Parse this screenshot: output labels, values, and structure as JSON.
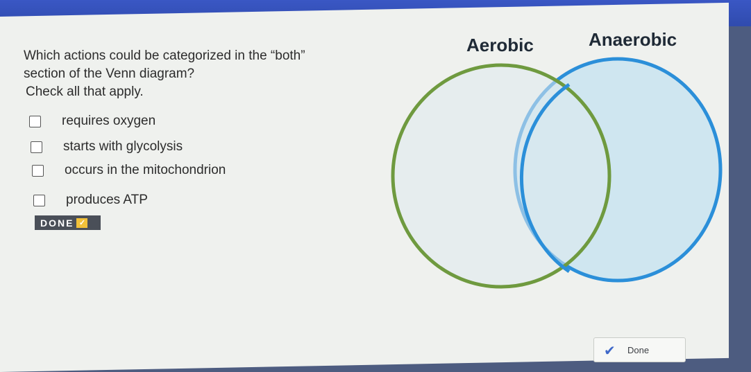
{
  "question": {
    "line1": "Which actions could be categorized in the “both”",
    "line2": "section of the Venn diagram?",
    "instruction": "Check all that apply."
  },
  "options": [
    {
      "label": "requires oxygen",
      "checked": false
    },
    {
      "label": "starts with glycolysis",
      "checked": false
    },
    {
      "label": "occurs in the mitochondrion",
      "checked": false
    },
    {
      "label": "produces ATP",
      "checked": false
    }
  ],
  "done_button": {
    "label": "DONE"
  },
  "venn": {
    "left_label": "Aerobic",
    "right_label": "Anaerobic",
    "left_color": "#6f9a3f",
    "right_color": "#2b8fd9",
    "right_fill": "#cfe6f0"
  },
  "footer": {
    "done_label": "Done"
  }
}
